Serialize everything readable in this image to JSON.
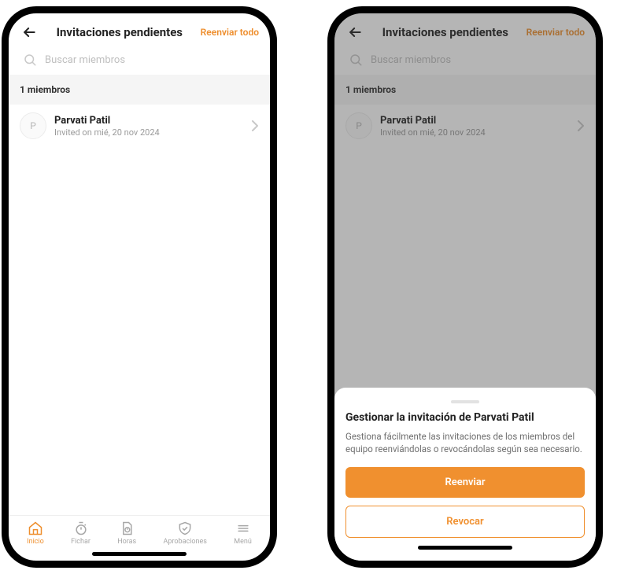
{
  "left": {
    "header": {
      "title": "Invitaciones pendientes",
      "resend_all": "Reenviar todo"
    },
    "search": {
      "placeholder": "Buscar miembros"
    },
    "section_count": "1 miembros",
    "member": {
      "initial": "P",
      "name": "Parvati Patil",
      "subline": "Invited on mié, 20 nov 2024"
    },
    "tabs": {
      "inicio": "Inicio",
      "fichar": "Fichar",
      "horas": "Horas",
      "aprobaciones": "Aprobaciones",
      "menu": "Menú"
    }
  },
  "right": {
    "header": {
      "title": "Invitaciones pendientes",
      "resend_all": "Reenviar todo"
    },
    "search": {
      "placeholder": "Buscar miembros"
    },
    "section_count": "1 miembros",
    "member": {
      "initial": "P",
      "name": "Parvati Patil",
      "subline": "Invited on mié, 20 nov 2024"
    },
    "sheet": {
      "title": "Gestionar la invitación de Parvati Patil",
      "desc": "Gestiona fácilmente las invitaciones de los miembros del equipo reenviándolas o revocándolas según sea necesario.",
      "primary": "Reenviar",
      "secondary": "Revocar"
    }
  }
}
